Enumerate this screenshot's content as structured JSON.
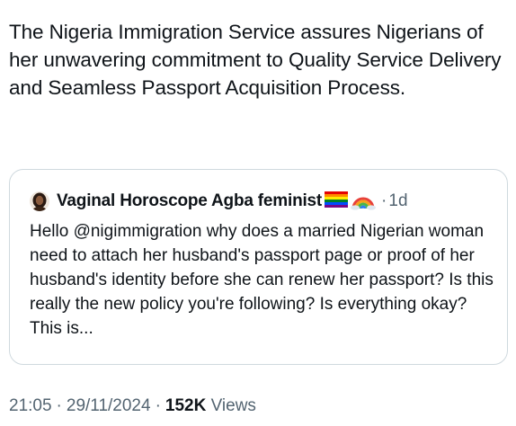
{
  "tweet": {
    "text": "The Nigeria Immigration Service assures Nigerians of her unwavering commitment to Quality Service Delivery and Seamless Passport Acquisition Process."
  },
  "quote": {
    "author": "Vaginal Horoscope Agba feminist",
    "separator": "·",
    "age": "1d",
    "text": "Hello @nigimmigration why does a married Nigerian woman need to attach her husband's passport page or proof of her husband's identity before she can renew her passport? Is this really the new policy you're following? Is everything okay? This is..."
  },
  "meta": {
    "time": "21:05",
    "dot1": "·",
    "date": "29/11/2024",
    "dot2": "·",
    "views_count": "152K",
    "views_label": "Views"
  },
  "icons": {
    "avatar": "avatar-photo",
    "flag": "rainbow-flag-icon",
    "rainbow": "rainbow-icon"
  }
}
